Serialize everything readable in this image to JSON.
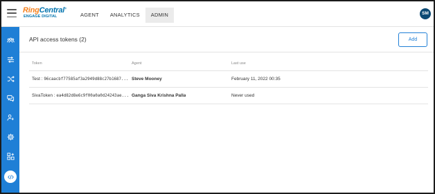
{
  "app": {
    "logo_ring": "Ring",
    "logo_central": "Central",
    "logo_tm": "®",
    "logo_sub": "ENGAGE DIGITAL"
  },
  "topnav": {
    "items": [
      {
        "label": "AGENT"
      },
      {
        "label": "ANALYTICS"
      },
      {
        "label": "ADMIN"
      }
    ],
    "active": "ADMIN"
  },
  "user": {
    "initials": "SM"
  },
  "sidebar": {
    "items": [
      {
        "icon": "users-icon"
      },
      {
        "icon": "routing-icon"
      },
      {
        "icon": "shuffle-icon"
      },
      {
        "icon": "chat-bubbles-icon"
      },
      {
        "icon": "agent-settings-icon"
      },
      {
        "icon": "gear-icon"
      },
      {
        "icon": "extensions-icon"
      },
      {
        "icon": "code-icon"
      }
    ],
    "active": "code-icon"
  },
  "page": {
    "title": "API access tokens (2)",
    "add_label": "Add"
  },
  "table": {
    "columns": [
      "Token",
      "Agent",
      "Last use"
    ],
    "rows": [
      {
        "token_name": "Test",
        "token_value": "96caacbf77585af3a2949d88c27b1687...",
        "agent": "Steve Mooney",
        "last_use": "February 11, 2022 00:35"
      },
      {
        "token_name": "SivaToken",
        "token_value": "ea4d82d8e6c9f00a0a0d24243ae...",
        "agent": "Ganga Siva Krishna Palla",
        "last_use": "Never used"
      }
    ]
  },
  "colors": {
    "brand_blue": "#1f7fd6",
    "logo_orange": "#f58220",
    "avatar_bg": "#0c4a74"
  }
}
